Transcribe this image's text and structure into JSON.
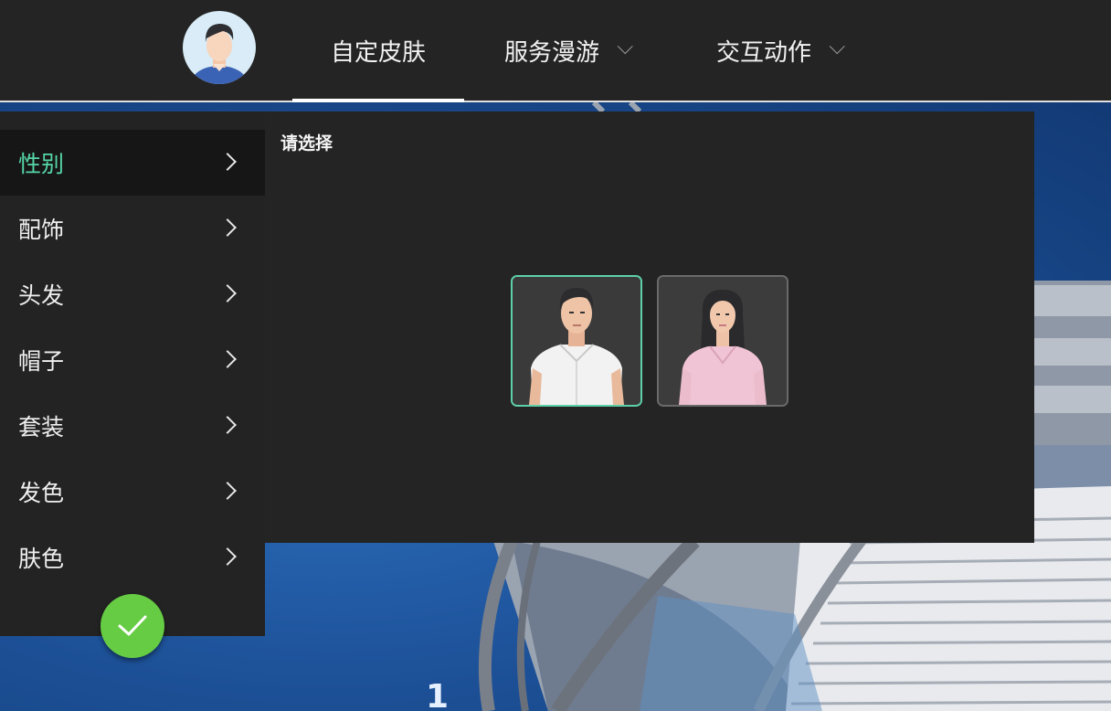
{
  "nav": {
    "tabs": [
      {
        "label": "自定皮肤",
        "active": true
      },
      {
        "label": "服务漫游",
        "has_dropdown": true
      },
      {
        "label": "交互动作",
        "has_dropdown": true
      }
    ]
  },
  "sidebar": {
    "items": [
      {
        "label": "性别",
        "active": true
      },
      {
        "label": "配饰"
      },
      {
        "label": "头发"
      },
      {
        "label": "帽子"
      },
      {
        "label": "套装"
      },
      {
        "label": "发色"
      },
      {
        "label": "肤色"
      }
    ]
  },
  "panel": {
    "title": "请选择",
    "options": [
      {
        "name": "male",
        "selected": true
      },
      {
        "name": "female",
        "selected": false
      }
    ]
  },
  "colors": {
    "accent": "#56d6a8",
    "confirm": "#66cc44",
    "panel_bg": "#242424"
  },
  "icons": [
    "avatar",
    "chevron-down-icon",
    "chevron-right-icon",
    "check-icon"
  ]
}
